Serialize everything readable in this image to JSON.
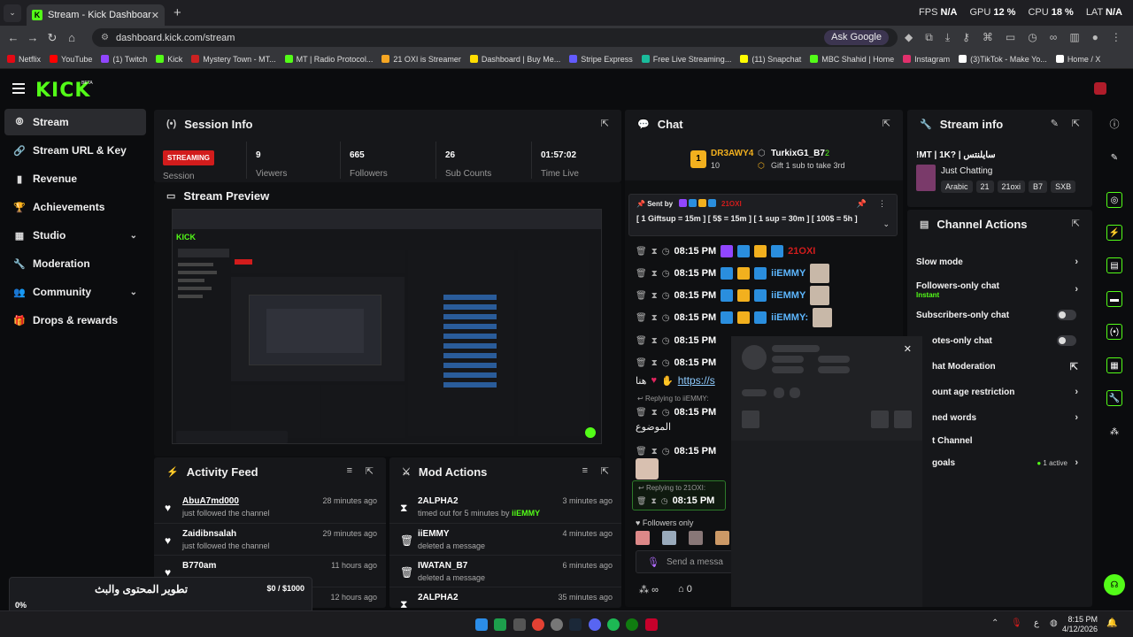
{
  "browser": {
    "tab_title": "Stream - Kick Dashboard",
    "url": "dashboard.kick.com/stream",
    "ask_google": "Ask Google",
    "stats": {
      "fps_label": "FPS",
      "fps": "N/A",
      "gpu_label": "GPU",
      "gpu": "12 %",
      "cpu_label": "CPU",
      "cpu": "18 %",
      "lat_label": "LAT",
      "lat": "N/A"
    },
    "bookmarks": [
      {
        "label": "Netflix",
        "color": "#e50914"
      },
      {
        "label": "YouTube",
        "color": "#ff0000"
      },
      {
        "label": "(1) Twitch",
        "color": "#9146ff"
      },
      {
        "label": "Kick",
        "color": "#53fc18"
      },
      {
        "label": "Mystery Town - MT...",
        "color": "#c22"
      },
      {
        "label": "MT | Radio Protocol...",
        "color": "#53fc18"
      },
      {
        "label": "21 OXI is Streamer",
        "color": "#f5a623"
      },
      {
        "label": "Dashboard | Buy Me...",
        "color": "#ffdd00"
      },
      {
        "label": "Stripe Express",
        "color": "#635bff"
      },
      {
        "label": "Free Live Streaming...",
        "color": "#1abc9c"
      },
      {
        "label": "(11) Snapchat",
        "color": "#fffc00"
      },
      {
        "label": "MBC Shahid | Home",
        "color": "#53fc18"
      },
      {
        "label": "Instagram",
        "color": "#e1306c"
      },
      {
        "label": "(3)TikTok - Make Yo...",
        "color": "#ffffff"
      },
      {
        "label": "Home / X",
        "color": "#ffffff"
      }
    ]
  },
  "kick": {
    "logo": "KICK",
    "beta": "BETA"
  },
  "sidebar": {
    "items": [
      {
        "label": "Stream"
      },
      {
        "label": "Stream URL & Key"
      },
      {
        "label": "Revenue"
      },
      {
        "label": "Achievements"
      },
      {
        "label": "Studio"
      },
      {
        "label": "Moderation"
      },
      {
        "label": "Community"
      },
      {
        "label": "Drops & rewards"
      }
    ]
  },
  "session": {
    "title": "Session Info",
    "badge": "STREAMING",
    "session_label": "Session",
    "viewers": "9",
    "viewers_label": "Viewers",
    "followers": "665",
    "followers_label": "Followers",
    "subs": "26",
    "subs_label": "Sub Counts",
    "time": "01:57:02",
    "time_label": "Time Live"
  },
  "preview": {
    "title": "Stream Preview"
  },
  "activity": {
    "title": "Activity Feed",
    "rows": [
      {
        "name": "AbuA7md000",
        "desc": "just followed the channel",
        "time": "28 minutes ago"
      },
      {
        "name": "Zaidibnsalah",
        "desc": "just followed the channel",
        "time": "29 minutes ago"
      },
      {
        "name": "B770am",
        "desc": "",
        "time": "11 hours ago"
      },
      {
        "name": "",
        "desc": "",
        "time": "12 hours ago"
      }
    ]
  },
  "mod": {
    "title": "Mod Actions",
    "rows": [
      {
        "name": "2ALPHA2",
        "desc": "timed out for 5 minutes by",
        "by": "iiEMMY",
        "time": "3 minutes ago"
      },
      {
        "name": "iiEMMY",
        "desc": "deleted a message",
        "by": "",
        "time": "4 minutes ago"
      },
      {
        "name": "IWATAN_B7",
        "desc": "deleted a message",
        "by": "",
        "time": "6 minutes ago"
      },
      {
        "name": "2ALPHA2",
        "desc": "",
        "by": "",
        "time": "35 minutes ago"
      }
    ]
  },
  "chat": {
    "title": "Chat",
    "top_rank": "1",
    "top_user": "DR3AWY4",
    "top_count": "10",
    "gifter": "TurkixG1_B7",
    "gifter_count": "2",
    "gift_text": "Gift 1 sub to take 3rd",
    "pinned_by": "Sent by",
    "pinned_user": "21OXI",
    "pinned_text": "[ 1 Giftsup = 15m ] [ 5$ = 15m ] [ 1 sup = 30m ] [ 100$ = 5h ]",
    "messages": [
      {
        "time": "08:15 PM",
        "user": "21OXI"
      },
      {
        "time": "08:15 PM",
        "user": "iiEMMY"
      },
      {
        "time": "08:15 PM",
        "user": "iiEMMY"
      },
      {
        "time": "08:15 PM",
        "user": "iiEMMY:"
      },
      {
        "time": "08:15 PM",
        "user": ""
      },
      {
        "time": "08:15 PM",
        "user": ""
      }
    ],
    "link_prefix": "هنا",
    "link": "https://s",
    "reply1": "Replying to iiEMMY:",
    "reply1_time": "08:15 PM",
    "arabic1": "الموضوع",
    "reply_time3": "08:15 PM",
    "reply2": "Replying to 21OXI:",
    "reply2_time": "08:15 PM",
    "followers_only": "Followers only",
    "send_placeholder": "Send a messa",
    "footer_count": "0",
    "footer_inf": "∞"
  },
  "info": {
    "title": "Stream info",
    "stream_title": "!MT | 1K? | سايلنتس",
    "category": "Just Chatting",
    "tags": [
      "Arabic",
      "21",
      "21oxi",
      "B7",
      "SXB"
    ]
  },
  "actions": {
    "title": "Channel Actions",
    "rows": [
      {
        "label": "Slow mode",
        "sub": ""
      },
      {
        "label": "Followers-only chat",
        "sub": "Instant"
      },
      {
        "label": "Subscribers-only chat",
        "sub": ""
      },
      {
        "label": "otes-only chat",
        "sub": ""
      },
      {
        "label": "hat Moderation",
        "sub": ""
      },
      {
        "label": "ount age restriction",
        "sub": ""
      },
      {
        "label": "ned words",
        "sub": ""
      },
      {
        "label": "t Channel",
        "sub": ""
      },
      {
        "label": "goals",
        "sub": "1 active"
      }
    ]
  },
  "goal": {
    "title": "تطوير المحتوى والبث",
    "amount": "$0 / $1000",
    "percent": "0%",
    "progress": 0
  },
  "taskbar": {
    "time": "8:15 PM",
    "date": "4/12/2026",
    "lang": "ع"
  },
  "colors": {
    "accent": "#53fc18",
    "live": "#d21c1c",
    "mention": "#5db7ff"
  }
}
